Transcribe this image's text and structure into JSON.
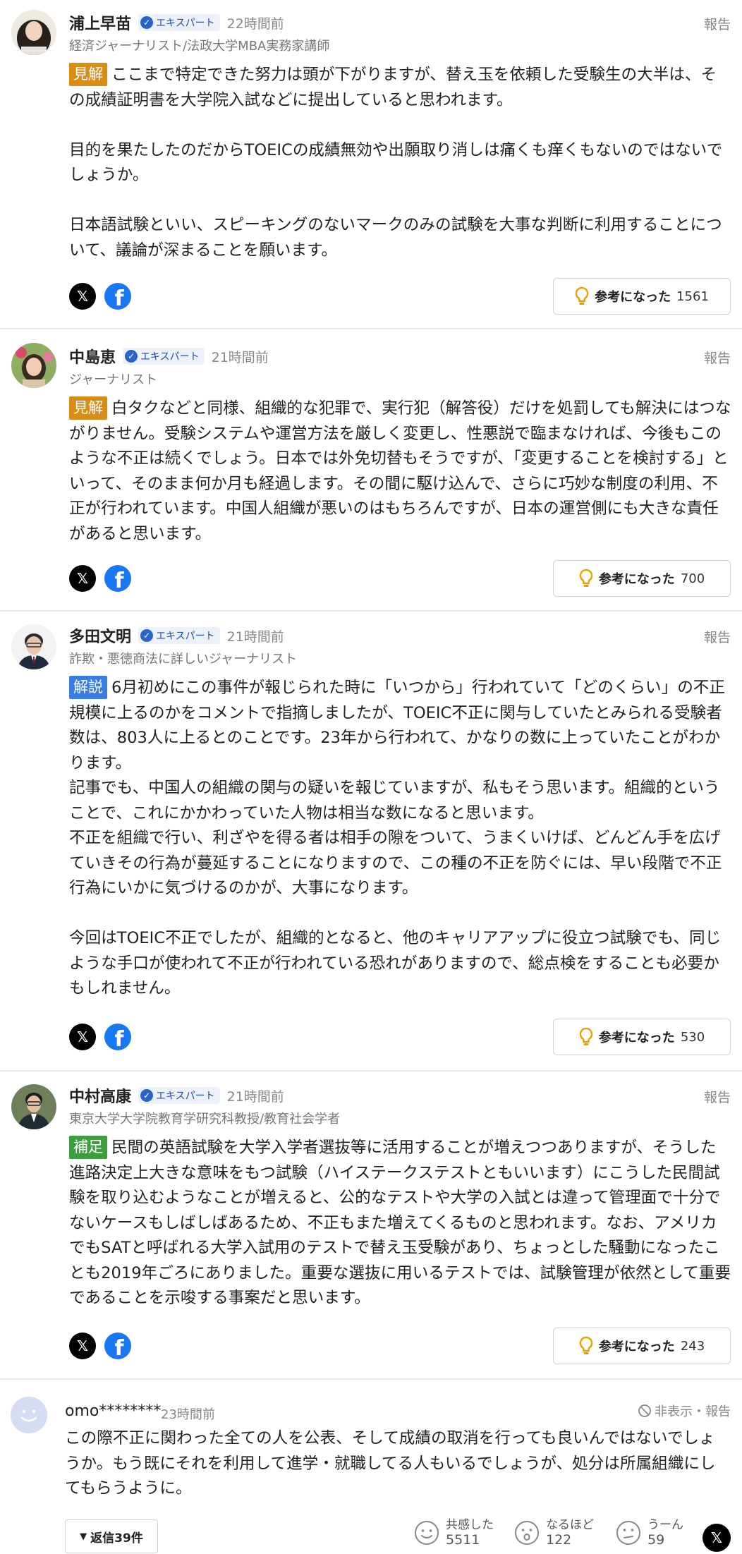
{
  "common": {
    "report": "報告",
    "badge": "エキスパート",
    "helpful_label": "参考になった",
    "x_glyph": "𝕏",
    "fb_glyph": "f"
  },
  "comments": [
    {
      "name": "浦上早苗",
      "time": "22時間前",
      "title": "経済ジャーナリスト/法政大学MBA実務家講師",
      "tag": "見解",
      "paragraphs": [
        "ここまで特定できた努力は頭が下がりますが、替え玉を依頼した受験生の大半は、その成績証明書を大学院入試などに提出していると思われます。",
        "目的を果たしたのだからTOEICの成績無効や出願取り消しは痛くも痒くもないのではないでしょうか。",
        "日本語試験といい、スピーキングのないマークのみの試験を大事な判断に利用することについて、議論が深まることを願います。"
      ],
      "helpful_count": "1561"
    },
    {
      "name": "中島恵",
      "time": "21時間前",
      "title": "ジャーナリスト",
      "tag": "見解",
      "paragraphs": [
        "白タクなどと同様、組織的な犯罪で、実行犯（解答役）だけを処罰しても解決にはつながりません。受験システムや運営方法を厳しく変更し、性悪説で臨まなければ、今後もこのような不正は続くでしょう。日本では外免切替もそうですが、「変更することを検討する」といって、そのまま何か月も経過します。その間に駆け込んで、さらに巧妙な制度の利用、不正が行われています。中国人組織が悪いのはもちろんですが、日本の運営側にも大きな責任があると思います。"
      ],
      "helpful_count": "700"
    },
    {
      "name": "多田文明",
      "time": "21時間前",
      "title": "詐欺・悪徳商法に詳しいジャーナリスト",
      "tag": "解説",
      "paragraphs": [
        "6月初めにこの事件が報じられた時に「いつから」行われていて「どのくらい」の不正規模に上るのかをコメントで指摘しましたが、TOEIC不正に関与していたとみられる受験者数は、803人に上るとのことです。23年から行われて、かなりの数に上っていたことがわかります。",
        "記事でも、中国人の組織の関与の疑いを報じていますが、私もそう思います。組織的ということで、これにかかわっていた人物は相当な数になると思います。",
        "不正を組織で行い、利ざやを得る者は相手の隙をついて、うまくいけば、どんどん手を広げていきその行為が蔓延することになりますので、この種の不正を防ぐには、早い段階で不正行為にいかに気づけるのかが、大事になります。",
        "今回はTOEIC不正でしたが、組織的となると、他のキャリアアップに役立つ試験でも、同じような手口が使われて不正が行われている恐れがありますので、総点検をすることも必要かもしれません。"
      ],
      "helpful_count": "530"
    },
    {
      "name": "中村高康",
      "time": "21時間前",
      "title": "東京大学大学院教育学研究科教授/教育社会学者",
      "tag": "補足",
      "paragraphs": [
        "民間の英語試験を大学入学者選抜等に活用することが増えつつありますが、そうした進路決定上大きな意味をもつ試験（ハイステークステストともいいます）にこうした民間試験を取り込むようなことが増えると、公的なテストや大学の入試とは違って管理面で十分でないケースもしばしばあるため、不正もまた増えてくるものと思われます。なお、アメリカでもSATと呼ばれる大学入試用のテストで替え玉受験があり、ちょっとした騒動になったことも2019年ごろにありました。重要な選抜に用いるテストでは、試験管理が依然として重要であることを示唆する事案だと思います。"
      ],
      "helpful_count": "243"
    }
  ],
  "user_comment": {
    "name": "omo********",
    "time": "23時間前",
    "hide_report": "非表示・報告",
    "text": "この際不正に関わった全ての人を公表、そして成績の取消を行っても良いんではないでしょうか。もう既にそれを利用して進学・就職してる人もいるでしょうが、処分は所属組織にしてもらうように。",
    "replies_label": "返信39件",
    "reactions": [
      {
        "label": "共感した",
        "count": "5511"
      },
      {
        "label": "なるほど",
        "count": "122"
      },
      {
        "label": "うーん",
        "count": "59"
      }
    ]
  }
}
